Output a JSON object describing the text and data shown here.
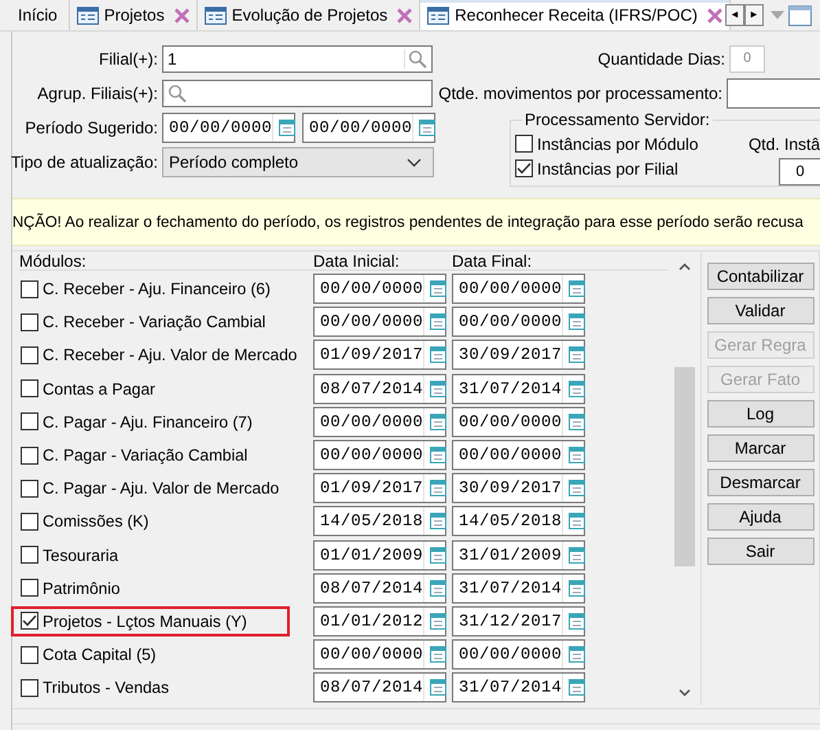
{
  "tabs": [
    {
      "label": "Início",
      "kind": "home",
      "selected": false
    },
    {
      "label": "Projetos",
      "kind": "form",
      "selected": false
    },
    {
      "label": "Evolução de Projetos",
      "kind": "form",
      "selected": false
    },
    {
      "label": "Reconhecer Receita (IFRS/POC)",
      "kind": "form",
      "selected": true
    }
  ],
  "tab_scroll": [
    "◂",
    "▸"
  ],
  "form": {
    "filial": {
      "label": "Filial(+):",
      "value": "1"
    },
    "agrup": {
      "label": "Agrup. Filiais(+):"
    },
    "periodo": {
      "label": "Período Sugerido:",
      "start": "00/00/0000",
      "end": "00/00/0000"
    },
    "tipo": {
      "label": "Tipo de atualização:",
      "value": "Período completo"
    },
    "quantidade_dias": {
      "label": "Quantidade Dias:",
      "value": "0",
      "disabled": true
    },
    "qtde_movimentos": {
      "label": "Qtde. movimentos por processamento:"
    },
    "processamento": {
      "title": "Processamento Servidor:",
      "options": [
        {
          "label": "Instâncias por Módulo",
          "checked": false
        },
        {
          "label": "Instâncias por Filial",
          "checked": true
        }
      ],
      "qtd_label": "Qtd. Instâ",
      "qtd_value": "0"
    }
  },
  "warning": "NÇÃO! Ao realizar o fechamento do período, os registros pendentes de integração para esse período serão recusa",
  "table": {
    "columns": [
      "Módulos:",
      "Data Inicial:",
      "Data Final:"
    ],
    "rows": [
      {
        "label": "C. Receber - Aju. Financeiro (6)",
        "checked": false,
        "highlighted": false,
        "start": "00/00/0000",
        "end": "00/00/0000"
      },
      {
        "label": "C. Receber - Variação Cambial",
        "checked": false,
        "highlighted": false,
        "start": "00/00/0000",
        "end": "00/00/0000"
      },
      {
        "label": "C. Receber - Aju. Valor de Mercado",
        "checked": false,
        "highlighted": false,
        "start": "01/09/2017",
        "end": "30/09/2017"
      },
      {
        "label": "Contas a Pagar",
        "checked": false,
        "highlighted": false,
        "start": "08/07/2014",
        "end": "31/07/2014"
      },
      {
        "label": "C. Pagar - Aju. Financeiro (7)",
        "checked": false,
        "highlighted": false,
        "start": "00/00/0000",
        "end": "00/00/0000"
      },
      {
        "label": "C. Pagar - Variação Cambial",
        "checked": false,
        "highlighted": false,
        "start": "00/00/0000",
        "end": "00/00/0000"
      },
      {
        "label": "C. Pagar - Aju. Valor de Mercado",
        "checked": false,
        "highlighted": false,
        "start": "01/09/2017",
        "end": "30/09/2017"
      },
      {
        "label": "Comissões (K)",
        "checked": false,
        "highlighted": false,
        "start": "14/05/2018",
        "end": "14/05/2018"
      },
      {
        "label": "Tesouraria",
        "checked": false,
        "highlighted": false,
        "start": "01/01/2009",
        "end": "31/01/2009"
      },
      {
        "label": "Patrimônio",
        "checked": false,
        "highlighted": false,
        "start": "08/07/2014",
        "end": "31/07/2014"
      },
      {
        "label": "Projetos - Lçtos Manuais (Y)",
        "checked": true,
        "highlighted": true,
        "start": "01/01/2012",
        "end": "31/12/2017"
      },
      {
        "label": "Cota Capital (5)",
        "checked": false,
        "highlighted": false,
        "start": "00/00/0000",
        "end": "00/00/0000"
      },
      {
        "label": "Tributos - Vendas",
        "checked": false,
        "highlighted": false,
        "start": "08/07/2014",
        "end": "31/07/2014"
      }
    ]
  },
  "buttons": [
    {
      "label": "Contabilizar",
      "disabled": false
    },
    {
      "label": "Validar",
      "disabled": false
    },
    {
      "label": "Gerar Regra",
      "disabled": true
    },
    {
      "label": "Gerar Fato",
      "disabled": true
    },
    {
      "label": "Log",
      "disabled": false
    },
    {
      "label": "Marcar",
      "disabled": false
    },
    {
      "label": "Desmarcar",
      "disabled": false
    },
    {
      "label": "Ajuda",
      "disabled": false
    },
    {
      "label": "Sair",
      "disabled": false
    }
  ]
}
